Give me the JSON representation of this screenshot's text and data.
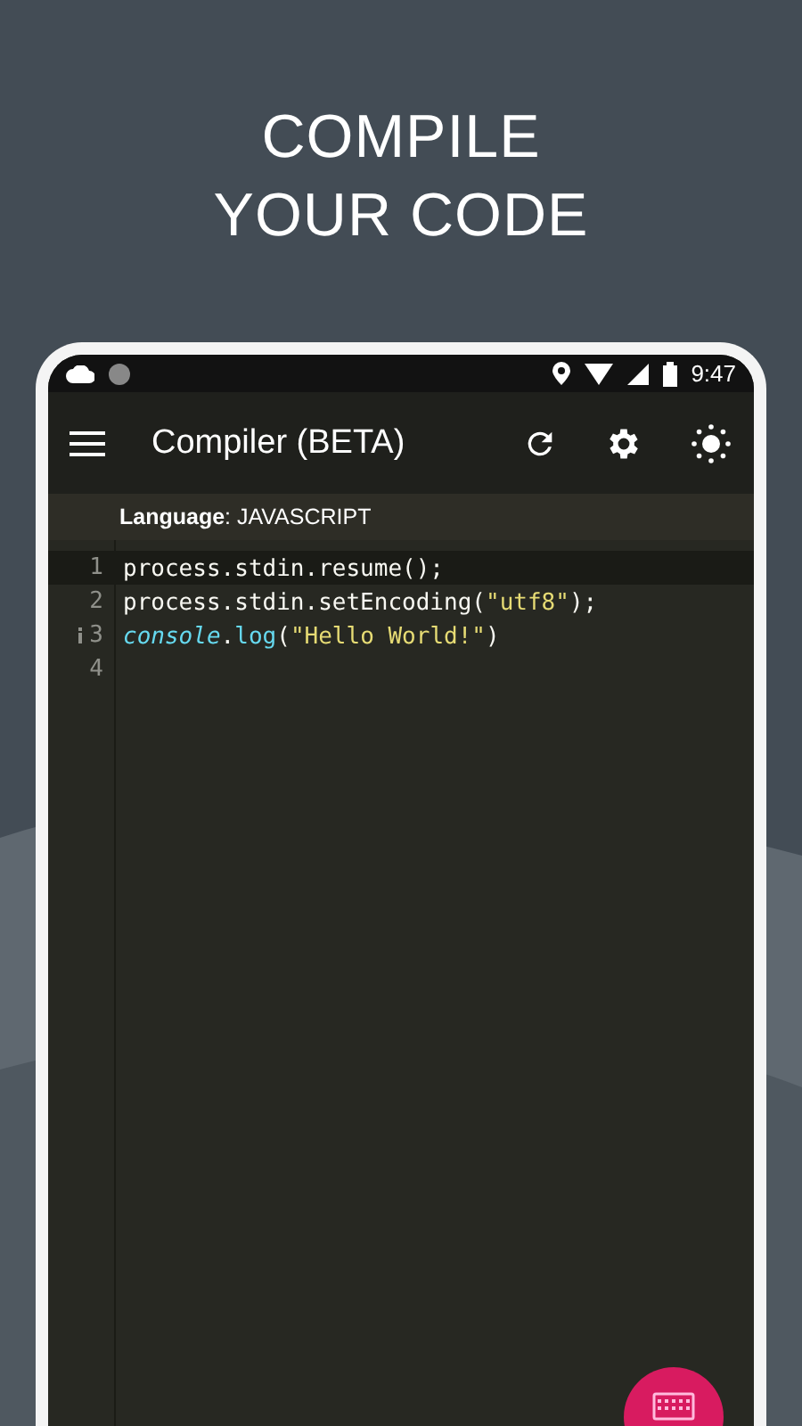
{
  "headline": [
    "COMPILE",
    "YOUR CODE"
  ],
  "status_bar": {
    "time": "9:47"
  },
  "app_bar": {
    "title": "Compiler (BETA)"
  },
  "language": {
    "text": "**Language**: JAVASCRIPT"
  },
  "editor": {
    "lines": [
      {
        "number": "1",
        "active": true,
        "info": false,
        "tokens": [
          {
            "kind": "plain",
            "text": "process.stdin.resume();"
          }
        ]
      },
      {
        "number": "2",
        "active": false,
        "info": false,
        "tokens": [
          {
            "kind": "plain",
            "text": "process.stdin.setEncoding("
          },
          {
            "kind": "string",
            "text": "\"utf8\""
          },
          {
            "kind": "plain",
            "text": ");"
          }
        ]
      },
      {
        "number": "3",
        "active": false,
        "info": true,
        "tokens": [
          {
            "kind": "builtin",
            "text": "console"
          },
          {
            "kind": "plain",
            "text": "."
          },
          {
            "kind": "function",
            "text": "log"
          },
          {
            "kind": "plain",
            "text": "("
          },
          {
            "kind": "string",
            "text": "\"Hello World!\""
          },
          {
            "kind": "plain",
            "text": ")"
          }
        ]
      },
      {
        "number": "4",
        "active": false,
        "info": false
      }
    ]
  }
}
